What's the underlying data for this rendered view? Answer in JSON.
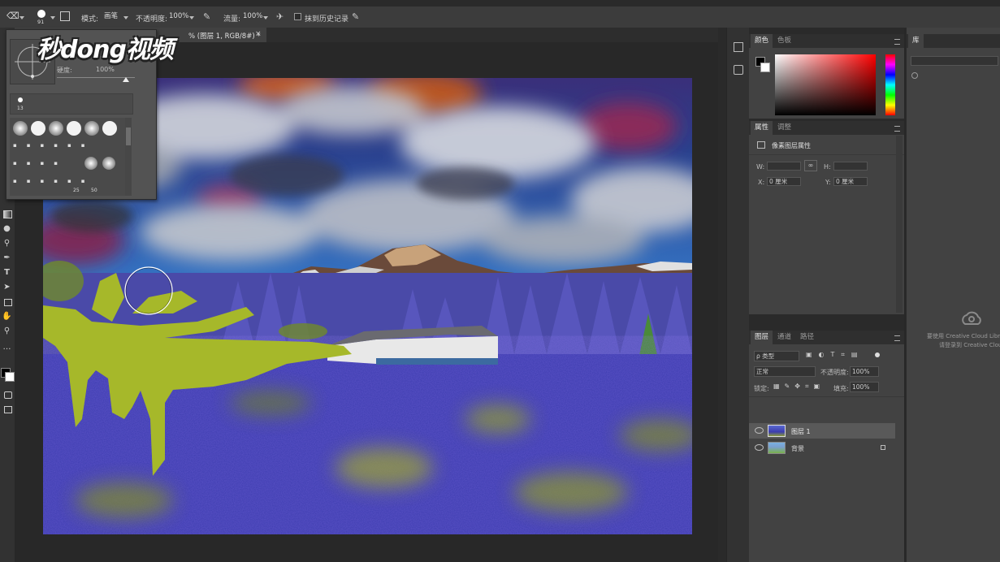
{
  "options_bar": {
    "brush_size": "91",
    "mode_label": "模式:",
    "mode_value": "画笔",
    "opacity_label": "不透明度:",
    "opacity_value": "100%",
    "flow_label": "流量:",
    "flow_value": "100%",
    "history_label": "抹到历史记录"
  },
  "document_tab": {
    "title": "% (图层 1, RGB/8#) *",
    "close": "×"
  },
  "brush_picker": {
    "hardness_label": "硬度:",
    "hardness_value": "100%",
    "selected_size": "13",
    "preset_sizes": [
      "25",
      "50"
    ]
  },
  "watermark": {
    "text": "秒dong视频"
  },
  "color_panel": {
    "tabs": [
      "颜色",
      "色板"
    ],
    "hue_gradient": [
      "#ff0000",
      "#ff00ff",
      "#0000ff",
      "#00ffff",
      "#00ff00",
      "#ffff00",
      "#ff0000"
    ]
  },
  "properties_panel": {
    "tabs": [
      "属性",
      "调整"
    ],
    "title": "像素图层属性",
    "w_label": "W:",
    "h_label": "H:",
    "x_label": "X:",
    "x_value": "0 厘米",
    "y_label": "Y:",
    "y_value": "0 厘米"
  },
  "layers_panel": {
    "tabs": [
      "图层",
      "通道",
      "路径"
    ],
    "filter_value": "ρ 类型",
    "blend_mode": "正常",
    "opacity_label": "不透明度:",
    "opacity_value": "100%",
    "lock_label": "锁定:",
    "fill_label": "填充:",
    "fill_value": "100%",
    "layers": [
      {
        "name": "图层 1",
        "selected": true
      },
      {
        "name": "背景",
        "selected": false,
        "locked": true
      }
    ]
  },
  "library_panel": {
    "tab": "库",
    "message_line1": "要使用 Creative Cloud Libra",
    "message_line2": "请登录到 Creative Cloud"
  },
  "colors": {
    "accent_panel": "#424242",
    "foreground": "#000000",
    "background": "#ffffff"
  }
}
